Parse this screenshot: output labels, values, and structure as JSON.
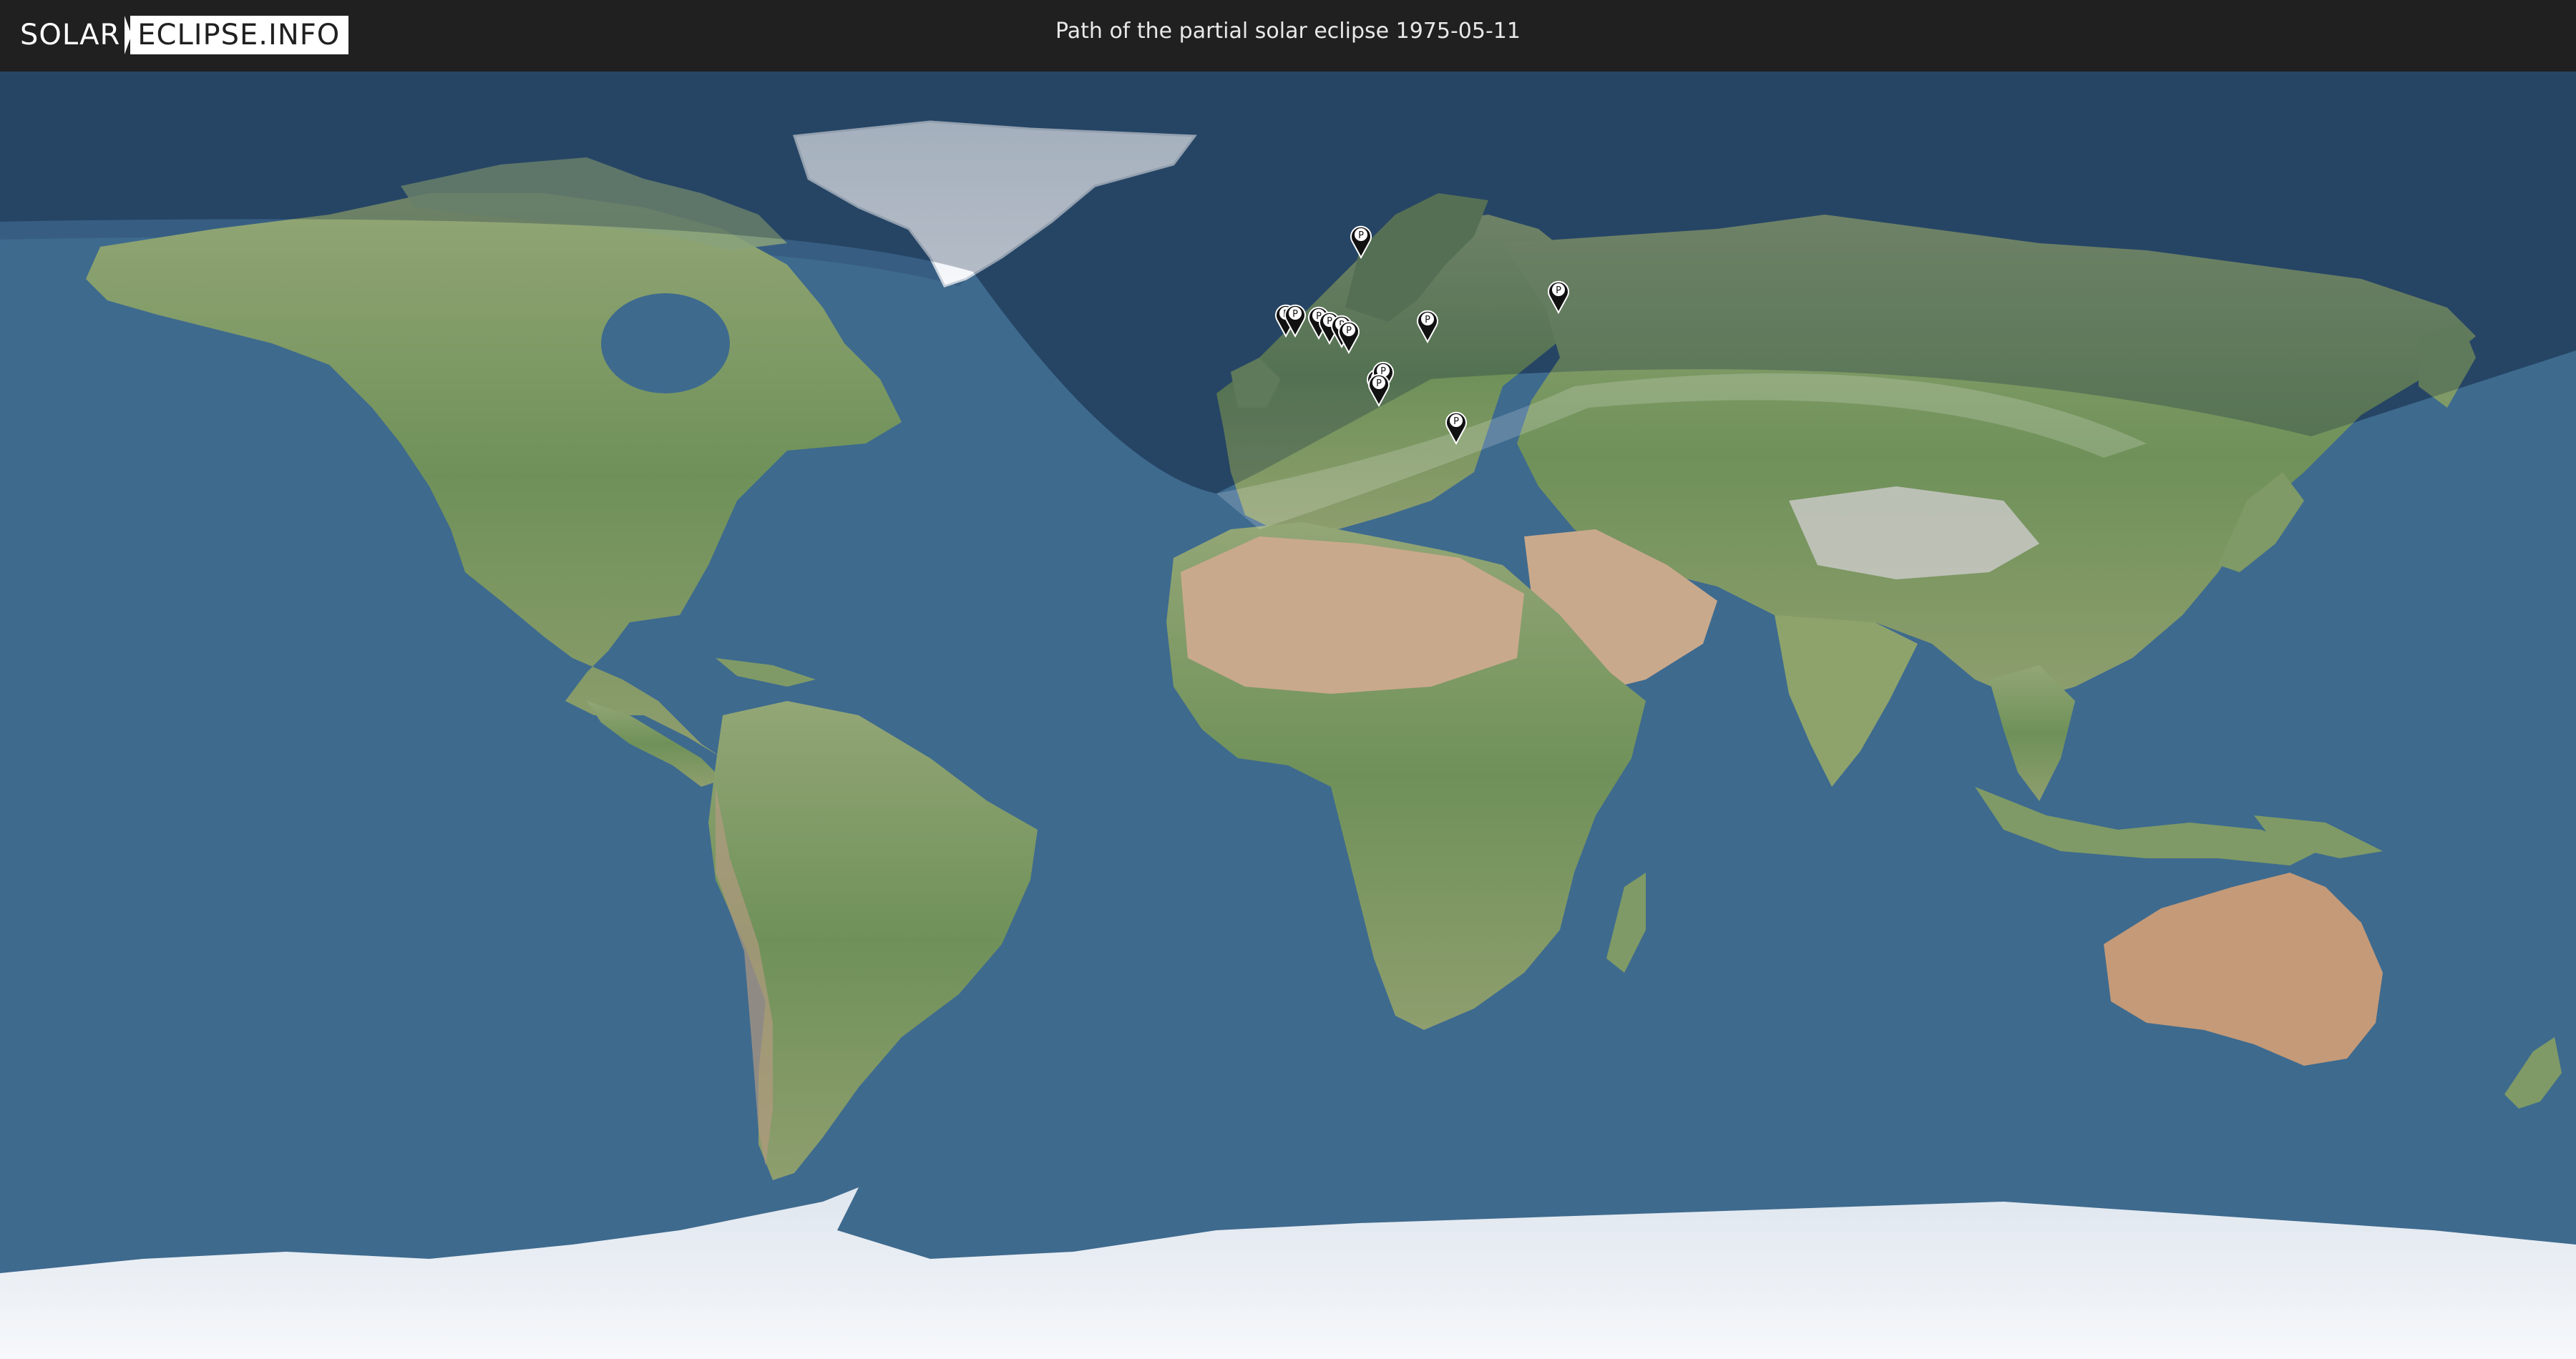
{
  "header": {
    "logo_left": "SOLAR",
    "logo_right": "ECLIPSE.INFO",
    "title": "Path of the partial solar eclipse 1975-05-11"
  },
  "map": {
    "ocean_color": "#3e6a8e",
    "land_color": "#7f9a66",
    "desert_color": "#c9a98c",
    "ice_color": "#e9eef4",
    "eclipse_shade_color": "#1e3553",
    "markers": [
      {
        "label": "P",
        "icon": "location-pin-icon"
      },
      {
        "label": "P",
        "icon": "location-pin-icon"
      },
      {
        "label": "P",
        "icon": "location-pin-icon"
      },
      {
        "label": "P",
        "icon": "location-pin-icon"
      },
      {
        "label": "P",
        "icon": "location-pin-icon"
      },
      {
        "label": "P",
        "icon": "location-pin-icon"
      },
      {
        "label": "P",
        "icon": "location-pin-icon"
      },
      {
        "label": "P",
        "icon": "location-pin-icon"
      },
      {
        "label": "P",
        "icon": "location-pin-icon"
      },
      {
        "label": "P",
        "icon": "location-pin-icon"
      },
      {
        "label": "P",
        "icon": "location-pin-icon"
      },
      {
        "label": "P",
        "icon": "location-pin-icon"
      },
      {
        "label": "P",
        "icon": "location-pin-icon"
      }
    ]
  }
}
